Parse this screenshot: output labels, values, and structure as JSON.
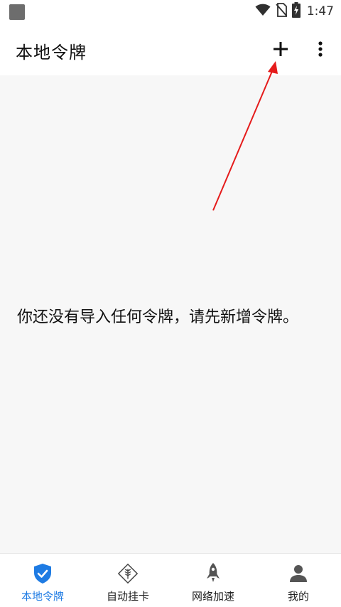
{
  "status_bar": {
    "time": "1:47",
    "icons": [
      "app-notification-icon",
      "wifi-icon",
      "no-sim-icon",
      "battery-charging-icon"
    ]
  },
  "app_bar": {
    "title": "本地令牌",
    "add_icon": "plus-icon",
    "more_icon": "more-vertical-icon"
  },
  "main": {
    "empty_message": "你还没有导入任何令牌，请先新增令牌。"
  },
  "bottom_nav": {
    "items": [
      {
        "label": "本地令牌",
        "icon": "shield-check-icon",
        "active": true
      },
      {
        "label": "自动挂卡",
        "icon": "wheat-diamond-icon",
        "active": false
      },
      {
        "label": "网络加速",
        "icon": "rocket-icon",
        "active": false
      },
      {
        "label": "我的",
        "icon": "person-icon",
        "active": false
      }
    ]
  },
  "colors": {
    "accent": "#1e7be3",
    "annotation_arrow": "#e51b1b",
    "background": "#f7f7f7"
  }
}
